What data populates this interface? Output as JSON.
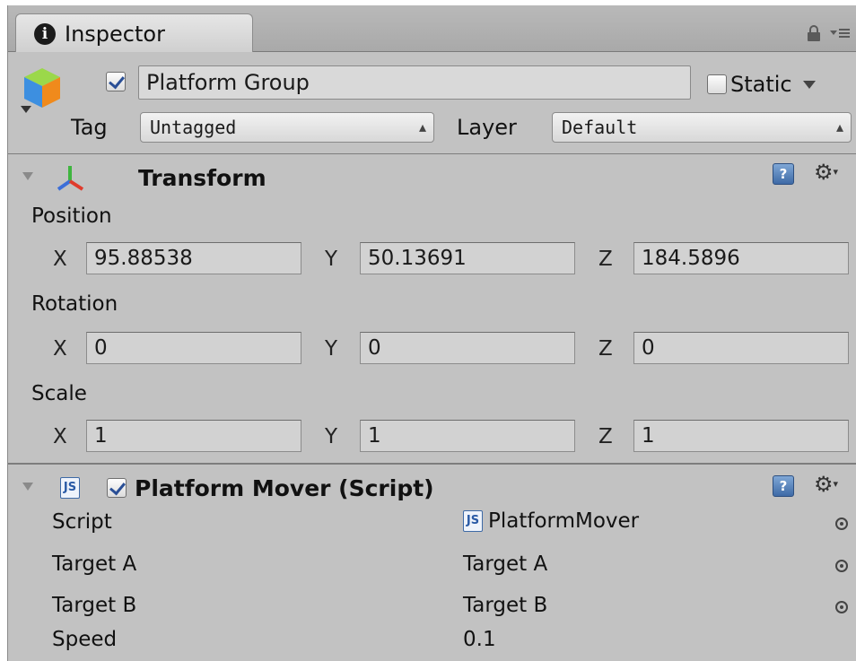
{
  "window": {
    "tab_label": "Inspector"
  },
  "gameobject": {
    "active": true,
    "name": "Platform Group",
    "static_label": "Static",
    "static_checked": false,
    "tag_label": "Tag",
    "tag_value": "Untagged",
    "layer_label": "Layer",
    "layer_value": "Default"
  },
  "transform": {
    "title": "Transform",
    "position": {
      "label": "Position",
      "x": "95.88538",
      "y": "50.13691",
      "z": "184.5896"
    },
    "rotation": {
      "label": "Rotation",
      "x": "0",
      "y": "0",
      "z": "0"
    },
    "scale": {
      "label": "Scale",
      "x": "1",
      "y": "1",
      "z": "1"
    },
    "axis_labels": {
      "x": "X",
      "y": "Y",
      "z": "Z"
    }
  },
  "script_component": {
    "enabled": true,
    "title": "Platform Mover (Script)",
    "properties": [
      {
        "label": "Script",
        "value": "PlatformMover",
        "icon": "js-icon",
        "picker": true
      },
      {
        "label": "Target A",
        "value": "Target A",
        "picker": true
      },
      {
        "label": "Target B",
        "value": "Target B",
        "picker": true
      },
      {
        "label": "Speed",
        "value": "0.1",
        "picker": false
      }
    ]
  },
  "icons": {
    "info": "i",
    "help": "?",
    "js": "JS",
    "gear": "⚙"
  }
}
